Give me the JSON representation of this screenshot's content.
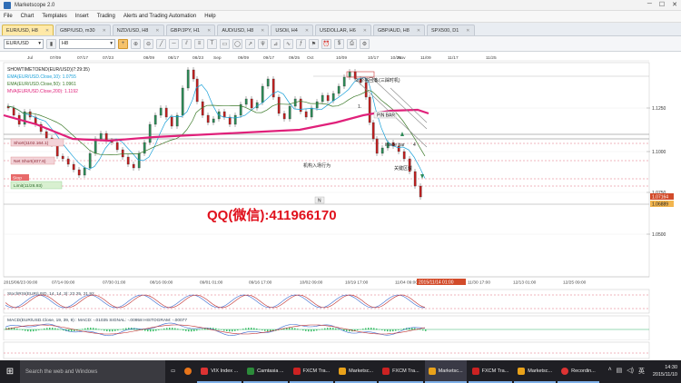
{
  "window": {
    "title": "Marketscope 2.0",
    "controls": [
      "─",
      "☐",
      "✕"
    ]
  },
  "menu": [
    "File",
    "Chart",
    "Templates",
    "Insert",
    "Trading",
    "Alerts and Trading Automation",
    "Help"
  ],
  "tabs": [
    {
      "label": "EUR/USD, H8",
      "active": true
    },
    {
      "label": "GBP/USD, m30",
      "active": false
    },
    {
      "label": "NZD/USD, H8",
      "active": false
    },
    {
      "label": "GBP/JPY, H1",
      "active": false
    },
    {
      "label": "AUD/USD, H8",
      "active": false
    },
    {
      "label": "USOil, H4",
      "active": false
    },
    {
      "label": "USDOLLAR, H6",
      "active": false
    },
    {
      "label": "GBP/AUD, H8",
      "active": false
    },
    {
      "label": "SPX500, D1",
      "active": false
    }
  ],
  "toolbar": {
    "symbol": "EUR/USD",
    "timeframe": "H8"
  },
  "chart": {
    "top_axis": [
      "Jul",
      "07/09",
      "07/17",
      "07/23",
      "08/09",
      "08/17",
      "08/23",
      "Sep",
      "09/09",
      "09/17",
      "09/25",
      "Oct",
      "10/09",
      "10/17",
      "10/25",
      "Nov",
      "11/09",
      "11/17",
      "11/25"
    ],
    "bottom_axis": [
      "2015/06/23 09:00",
      "07/14 09:00",
      "07/30 01:00",
      "08/16 09:00",
      "09/01 01:00",
      "09/16 17:00",
      "10/02 09:00",
      "10/19 17:00",
      "11/04 09:00",
      "11/30 17:00",
      "12/13 01:00",
      "12/25 09:00"
    ],
    "cursor_time": "2015/11/14 01:00",
    "price_ticks": [
      "1.1250",
      "1.1000",
      "1.0750",
      "1.0500"
    ],
    "current_price": "1.07164",
    "current_price2": "1.06889",
    "legend": [
      "SHOWTIMETOEND(EUR/USD)(7:29:35)",
      "EMA(EUR/USD.Close,10): 1.0755",
      "EMA(EUR/USD.Close,50): 1.0961",
      "MVA(EUR/USD.Close,200): 1.1192"
    ],
    "order_labels": [
      "Short(1102.164.1)",
      "Net Short(407.6)",
      "Stop",
      "Limit(11/26.93)"
    ],
    "annotations": [
      "3.价格回落",
      "5.(三踩时机)",
      "1.",
      "PIN BAR",
      "inside bar",
      "4",
      "机构入场行为",
      "关键区域",
      "N"
    ],
    "overlay_text": "QQ(微信):411966170",
    "sub1_label": "StochRSI(EUR/USD, 14, 14, 3): 22.25, 21.92",
    "sub2_label": "MACD(EUR/USD.Close, 19, 39, 9) : MACD: -.01035  SIGNAL: -.00958  HISTOGRAM: -.00077"
  },
  "taskbar": {
    "search": "Search the web and Windows",
    "apps": [
      "VIX Index ...",
      "Camtasia ...",
      "FXCM Tra...",
      "Marketsc...",
      "FXCM Tra...",
      "Marketsc...",
      "FXCM Tra...",
      "Marketsc...",
      "Recordin..."
    ],
    "time": "14:30",
    "date": "2015/11/10",
    "ime": "英"
  },
  "colors": {
    "ma200": "#e0207a",
    "ema10": "#1aa0d8",
    "ema50": "#3c7a2a",
    "bull": "#2e8b57",
    "bear": "#c02020",
    "overlay": "#e0101c"
  }
}
